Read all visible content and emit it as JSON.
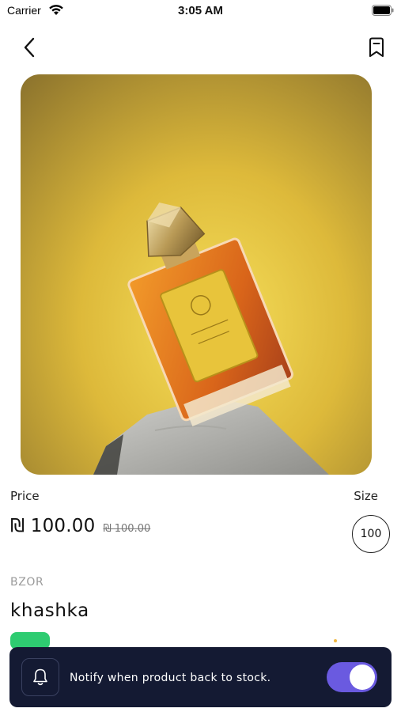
{
  "status_bar": {
    "carrier": "Carrier",
    "time": "3:05 AM"
  },
  "nav": {
    "back_icon": "chevron-left-icon",
    "bookmark_icon": "bookmark-icon"
  },
  "product": {
    "price_label": "Price",
    "size_label": "Size",
    "price_current": "₪ 100.00",
    "price_old": "₪ 100.00",
    "size": "100",
    "brand": "BZOR",
    "name": "khashka"
  },
  "notify": {
    "icon": "bell-icon",
    "text": "Notify when product back to stock.",
    "enabled": true
  },
  "colors": {
    "accent": "#6a5ae0",
    "notify_bg": "#141a33",
    "stock_badge": "#2ecc71"
  }
}
